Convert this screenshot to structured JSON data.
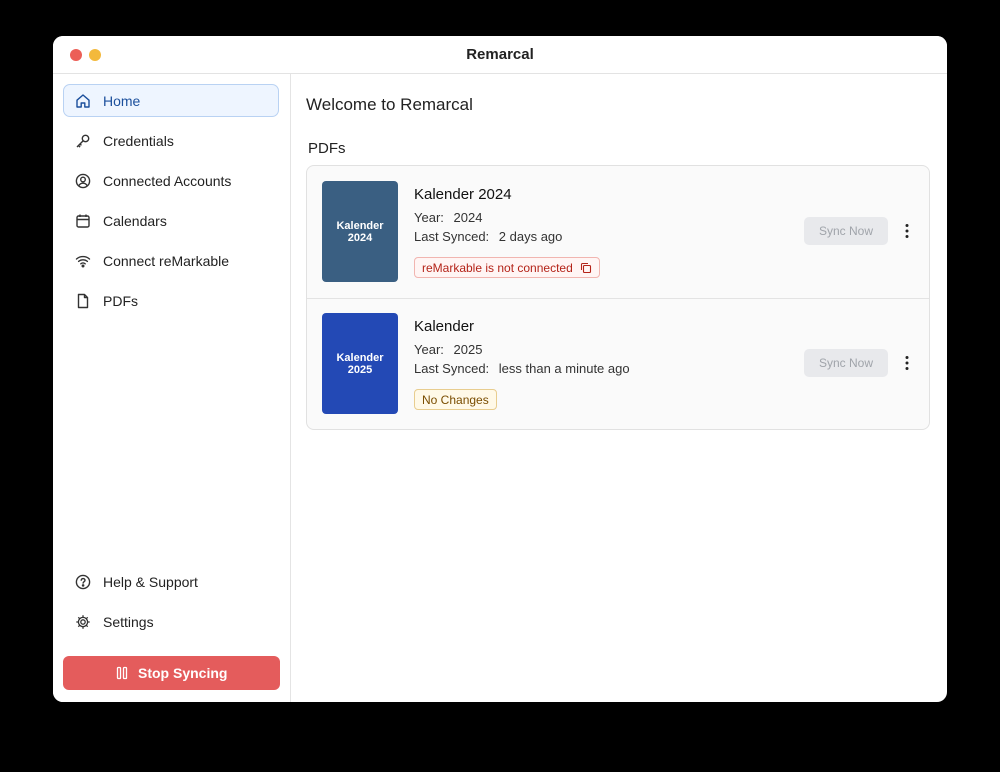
{
  "window": {
    "title": "Remarcal"
  },
  "sidebar": {
    "items": [
      {
        "label": "Home",
        "icon": "home-icon",
        "active": true
      },
      {
        "label": "Credentials",
        "icon": "key-icon"
      },
      {
        "label": "Connected Accounts",
        "icon": "user-circle-icon"
      },
      {
        "label": "Calendars",
        "icon": "calendar-icon"
      },
      {
        "label": "Connect reMarkable",
        "icon": "wifi-icon"
      },
      {
        "label": "PDFs",
        "icon": "file-icon"
      }
    ],
    "bottom_items": [
      {
        "label": "Help & Support",
        "icon": "help-circle-icon"
      },
      {
        "label": "Settings",
        "icon": "gear-icon"
      }
    ],
    "stop_button": {
      "label": "Stop Syncing",
      "icon": "pause-icon",
      "color": "#e45c5c"
    }
  },
  "main": {
    "welcome": "Welcome to Remarcal",
    "section_title": "PDFs",
    "year_label": "Year:",
    "last_synced_label": "Last Synced:",
    "sync_label": "Sync Now",
    "pdfs": [
      {
        "name": "Kalender 2024",
        "cover_line1": "Kalender",
        "cover_line2": "2024",
        "cover_color": "#3a5f82",
        "year": "2024",
        "last_synced": "2 days ago",
        "status": "reMarkable is not connected",
        "status_type": "error"
      },
      {
        "name": "Kalender",
        "cover_line1": "Kalender",
        "cover_line2": "2025",
        "cover_color": "#2349b5",
        "year": "2025",
        "last_synced": "less than a minute ago",
        "status": "No Changes",
        "status_type": "warning"
      }
    ]
  }
}
